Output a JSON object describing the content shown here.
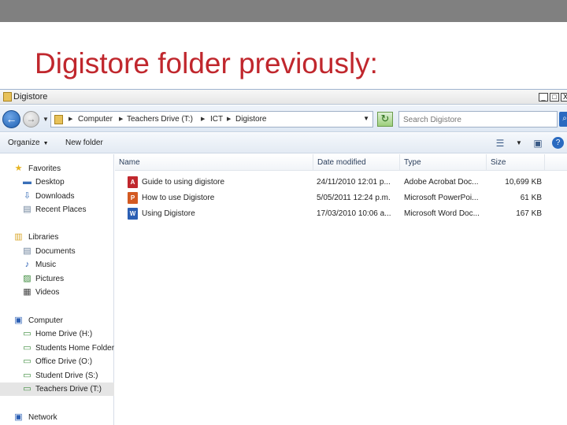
{
  "slide": {
    "title": "Digistore folder previously:"
  },
  "window": {
    "title": "Digistore",
    "buttons": {
      "minimize": "_",
      "maximize": "□",
      "close": "X"
    }
  },
  "address": {
    "breadcrumbs": [
      "Computer",
      "Teachers Drive (T:)",
      "ICT",
      "Digistore"
    ],
    "search_placeholder": "Search Digistore"
  },
  "toolbar": {
    "organize": "Organize",
    "new_folder": "New folder"
  },
  "nav": {
    "favorites": {
      "label": "Favorites",
      "items": [
        "Desktop",
        "Downloads",
        "Recent Places"
      ]
    },
    "libraries": {
      "label": "Libraries",
      "items": [
        "Documents",
        "Music",
        "Pictures",
        "Videos"
      ]
    },
    "computer": {
      "label": "Computer",
      "items": [
        "Home Drive (H:)",
        "Students Home Folder",
        "Office Drive (O:)",
        "Student Drive (S:)",
        "Teachers Drive (T:)"
      ],
      "selected": "Teachers Drive (T:)"
    },
    "network": {
      "label": "Network"
    }
  },
  "columns": [
    "Name",
    "Date modified",
    "Type",
    "Size"
  ],
  "files": [
    {
      "name": "Guide to using digistore",
      "date": "24/11/2010 12:01 p...",
      "type": "Adobe Acrobat Doc...",
      "size": "10,699 KB",
      "icon": "pdf-icon",
      "icon_color": "#c0272d"
    },
    {
      "name": "How to use Digistore",
      "date": "5/05/2011 12:24 p.m.",
      "type": "Microsoft PowerPoi...",
      "size": "61 KB",
      "icon": "powerpoint-icon",
      "icon_color": "#d35a22"
    },
    {
      "name": "Using Digistore",
      "date": "17/03/2010 10:06 a...",
      "type": "Microsoft Word Doc...",
      "size": "167 KB",
      "icon": "word-icon",
      "icon_color": "#2b5fb4"
    }
  ],
  "colors": {
    "title_red": "#c0272d",
    "top_band": "#808080"
  }
}
